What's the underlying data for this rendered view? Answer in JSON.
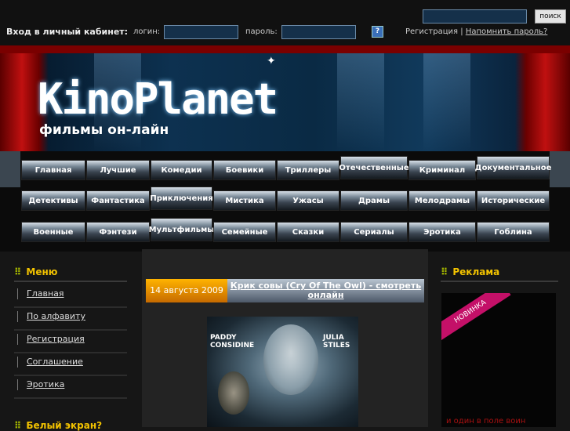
{
  "header": {
    "search_button": "поиск",
    "login_title": "Вход в личный кабинет:",
    "login_label": "логин:",
    "password_label": "пароль:",
    "help_icon": "?",
    "register_link": "Регистрация",
    "separator": "|",
    "forgot_link": "Напомнить пароль?"
  },
  "banner": {
    "logo": "KinoPlanet",
    "tagline": "фильмы он-лайн"
  },
  "nav": {
    "row1": [
      "Главная",
      "Лучшие",
      "Комедии",
      "Боевики",
      "Триллеры",
      "Отечественные",
      "Криминал",
      "Документальное"
    ],
    "row2": [
      "Детективы",
      "Фантастика",
      "Приключения",
      "Мистика",
      "Ужасы",
      "Драмы",
      "Мелодрамы",
      "Исторические"
    ],
    "row3": [
      "Военные",
      "Фэнтези",
      "Мультфильмы",
      "Семейные",
      "Сказки",
      "Сериалы",
      "Эротика",
      "Гоблина"
    ]
  },
  "left": {
    "menu_title": "Меню",
    "links": [
      "Главная",
      "По алфавиту",
      "Регистрация",
      "Соглашение",
      "Эротика"
    ],
    "next_title": "Белый экран?"
  },
  "article": {
    "date": "14 августа 2009",
    "title": "Крик совы (Cry Of The Owl) - смотреть онлайн",
    "poster_actor1": "PADDY CONSIDINE",
    "poster_actor2": "JULIA STILES"
  },
  "right": {
    "ad_title": "Реклама",
    "ad_badge": "НОВИНКА",
    "ad_caption": "и один в поле воин"
  },
  "colors": {
    "accent": "#f3c300",
    "date_bg": "#ffb300"
  }
}
